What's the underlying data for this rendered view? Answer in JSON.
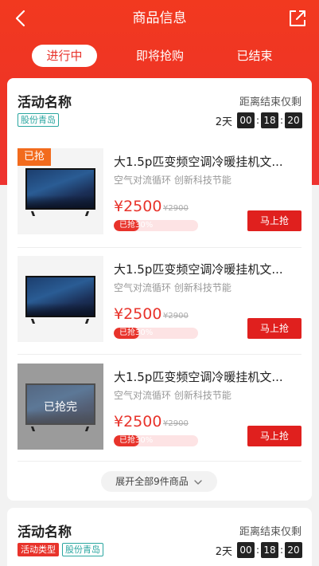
{
  "header": {
    "title": "商品信息",
    "tabs": [
      {
        "label": "进行中",
        "active": true
      },
      {
        "label": "即将抢购",
        "active": false
      },
      {
        "label": "已结束",
        "active": false
      }
    ]
  },
  "colors": {
    "brand_red": "#e8332b",
    "tag_teal": "#2aa6a0",
    "badge_orange": "#f26b1d"
  },
  "activities": [
    {
      "name": "活动名称",
      "countdown_label": "距离结束仅剩",
      "tags": [
        "股份青岛"
      ],
      "timer": {
        "days": "2天",
        "hours": "00",
        "minutes": "18",
        "seconds": "20"
      },
      "items": [
        {
          "badge": "已抢",
          "title": "大1.5p匹变频空调冷暖挂机文...",
          "subtitle": "空气对流循环 创新科技节能",
          "price": "¥2500",
          "old_price": "¥2900",
          "progress_text": "已抢30%",
          "progress": 0.3,
          "button": "马上抢",
          "sold_out_text": ""
        },
        {
          "badge": "",
          "title": "大1.5p匹变频空调冷暖挂机文...",
          "subtitle": "空气对流循环 创新科技节能",
          "price": "¥2500",
          "old_price": "¥2900",
          "progress_text": "已抢30%",
          "progress": 0.3,
          "button": "马上抢",
          "sold_out_text": ""
        },
        {
          "badge": "",
          "title": "大1.5p匹变频空调冷暖挂机文...",
          "subtitle": "空气对流循环 创新科技节能",
          "price": "¥2500",
          "old_price": "¥2900",
          "progress_text": "已抢30%",
          "progress": 0.3,
          "button": "马上抢",
          "sold_out_text": "已抢完"
        }
      ],
      "expand_label": "展开全部9件商品"
    },
    {
      "name": "活动名称",
      "countdown_label": "距离结束仅剩",
      "tags": [
        "活动类型",
        "股份青岛"
      ],
      "timer": {
        "days": "2天",
        "hours": "00",
        "minutes": "18",
        "seconds": "20"
      }
    }
  ],
  "icons": {
    "back": "chevron-left-icon",
    "share": "share-icon",
    "expand": "chevron-down-icon"
  }
}
